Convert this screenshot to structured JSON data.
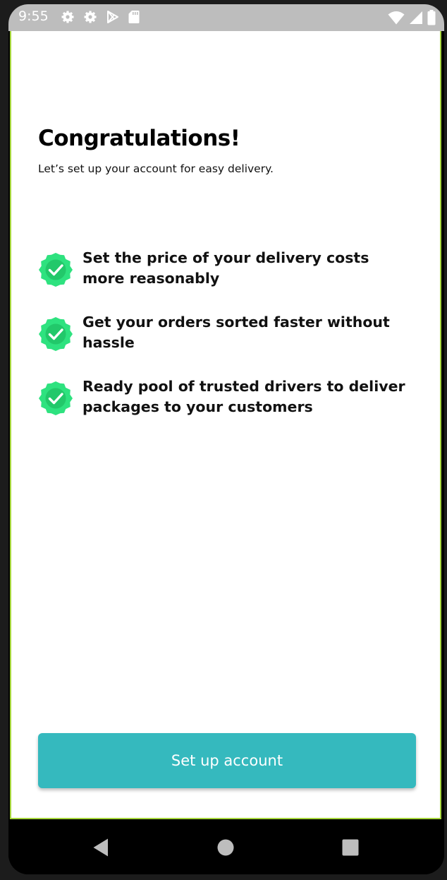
{
  "status_bar": {
    "time": "9:55",
    "left_icons": [
      "settings-icon",
      "settings-icon",
      "play-store-icon",
      "sd-card-icon"
    ],
    "right_icons": [
      "wifi-icon",
      "signal-icon",
      "battery-icon"
    ]
  },
  "header": {
    "title": "Congratulations!",
    "subtitle": "Let’s set up your account for easy delivery."
  },
  "features": [
    {
      "icon": "verified-badge-icon",
      "text": "Set the price of your delivery costs more reasonably"
    },
    {
      "icon": "verified-badge-icon",
      "text": "Get your orders sorted faster without hassle"
    },
    {
      "icon": "verified-badge-icon",
      "text": "Ready pool of trusted drivers to deliver packages to your customers"
    }
  ],
  "cta": {
    "label": "Set up account"
  },
  "nav_bar": {
    "buttons": [
      "back-icon",
      "home-icon",
      "recents-icon"
    ]
  },
  "colors": {
    "accent": "#35b9be",
    "badge": "#2ee27f",
    "status_bar": "#bdbdbd",
    "screen_border": "#a6d63c"
  }
}
